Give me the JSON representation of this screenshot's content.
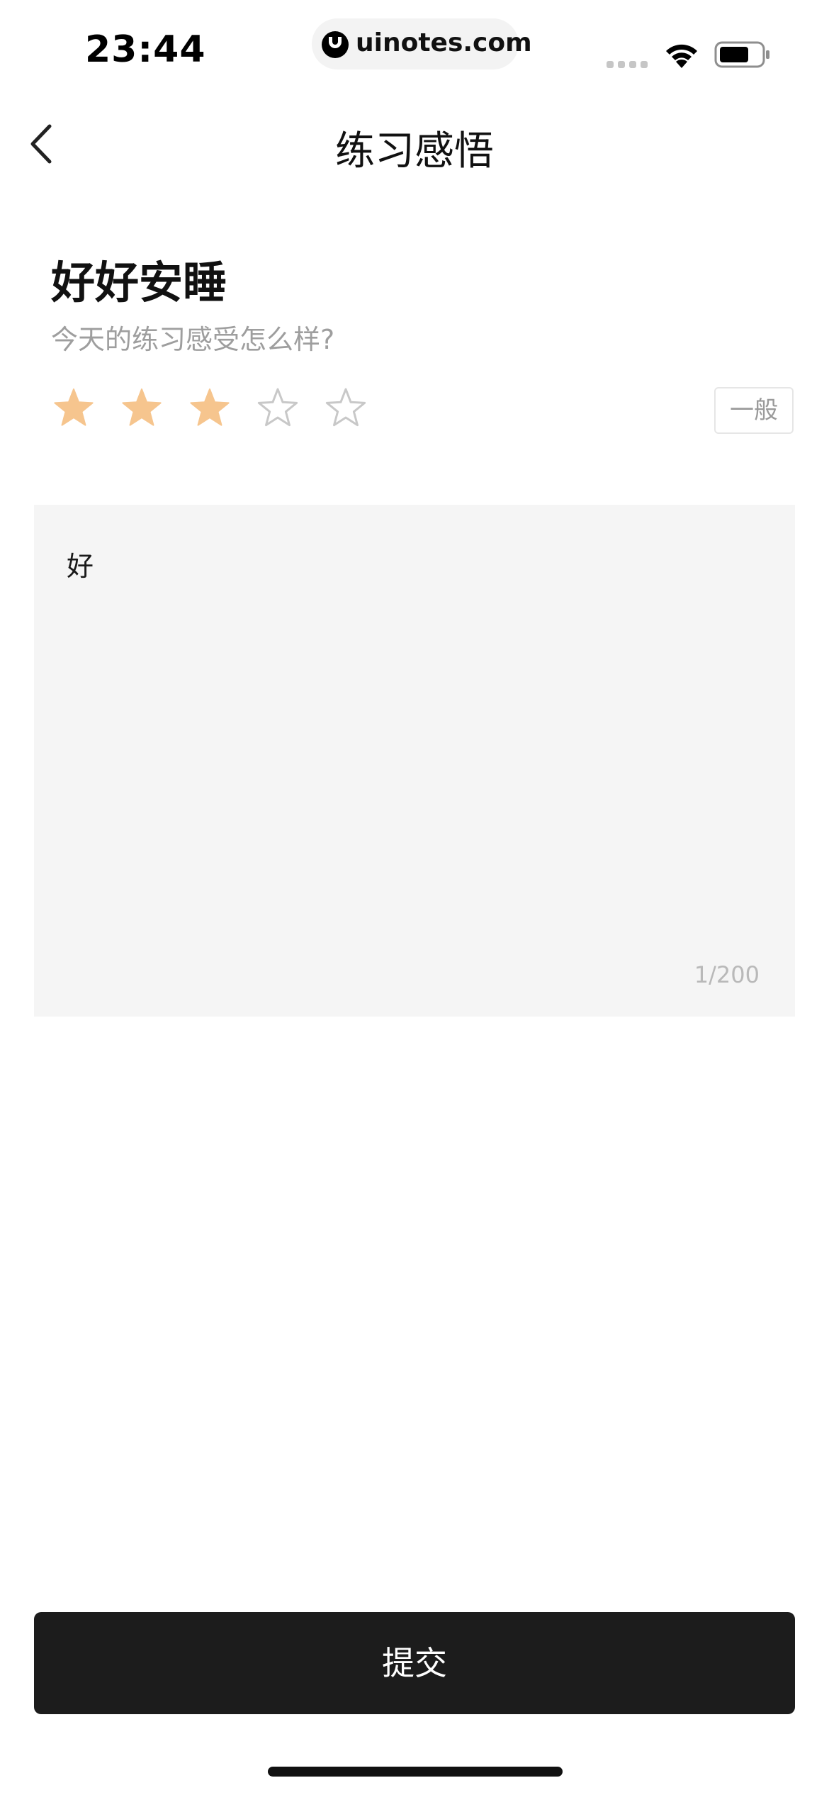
{
  "status_bar": {
    "time": "23:44",
    "url": "uinotes.com",
    "wifi_icon": "wifi-icon",
    "battery_icon": "battery-icon"
  },
  "nav": {
    "back_icon": "chevron-left-icon",
    "title": "练习感悟"
  },
  "practice": {
    "title": "好好安睡",
    "prompt": "今天的练习感受怎么样?"
  },
  "rating": {
    "value": 3,
    "max": 5,
    "label": "一般",
    "filled_color": "#f6c58e",
    "empty_color": "#c8c8c8"
  },
  "reflection": {
    "value": "好",
    "counter": "1/200"
  },
  "actions": {
    "submit_label": "提交"
  }
}
